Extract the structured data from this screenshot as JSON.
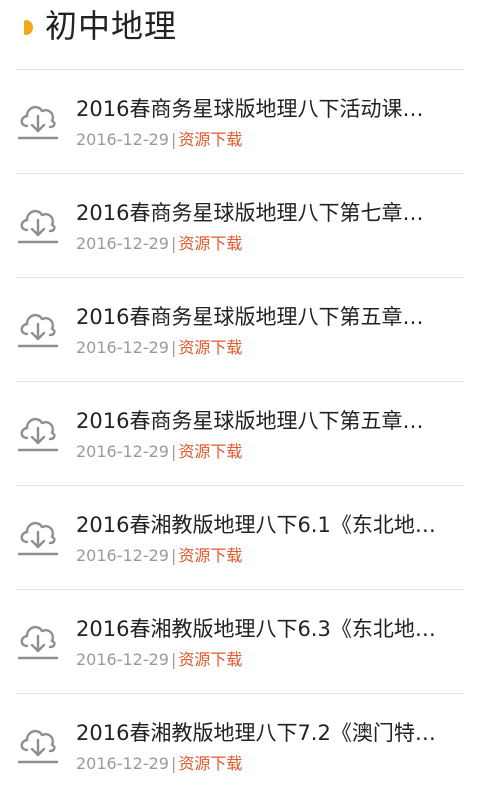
{
  "header": {
    "title": "初中地理",
    "accent_color": "#f2a81d"
  },
  "items": [
    {
      "title": "2016春商务星球版地理八下活动课…",
      "date": "2016-12-29",
      "separator": "|",
      "tag": "资源下载",
      "icon": "cloud-download-icon"
    },
    {
      "title": "2016春商务星球版地理八下第七章…",
      "date": "2016-12-29",
      "separator": "|",
      "tag": "资源下载",
      "icon": "cloud-download-icon"
    },
    {
      "title": "2016春商务星球版地理八下第五章…",
      "date": "2016-12-29",
      "separator": "|",
      "tag": "资源下载",
      "icon": "cloud-download-icon"
    },
    {
      "title": "2016春商务星球版地理八下第五章…",
      "date": "2016-12-29",
      "separator": "|",
      "tag": "资源下载",
      "icon": "cloud-download-icon"
    },
    {
      "title": "2016春湘教版地理八下6.1《东北地…",
      "date": "2016-12-29",
      "separator": "|",
      "tag": "资源下载",
      "icon": "cloud-download-icon"
    },
    {
      "title": "2016春湘教版地理八下6.3《东北地…",
      "date": "2016-12-29",
      "separator": "|",
      "tag": "资源下载",
      "icon": "cloud-download-icon"
    },
    {
      "title": "2016春湘教版地理八下7.2《澳门特…",
      "date": "2016-12-29",
      "separator": "|",
      "tag": "资源下载",
      "icon": "cloud-download-icon"
    }
  ]
}
